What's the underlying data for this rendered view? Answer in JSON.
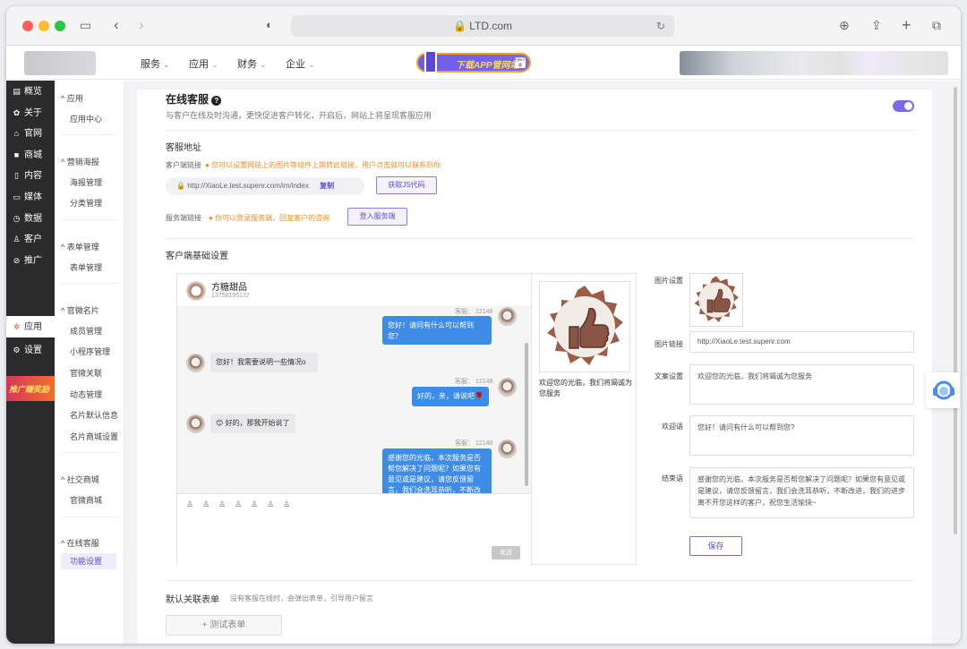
{
  "browser": {
    "url": "LTD.com"
  },
  "topnav": {
    "items": [
      "服务",
      "应用",
      "财务",
      "企业"
    ],
    "app_button": "下载APP管网站",
    "qr_text": "扫码下载"
  },
  "sidebar": {
    "items": [
      "概览",
      "关于",
      "官网",
      "商城",
      "内容",
      "媒体",
      "数据",
      "客户",
      "推广",
      "应用",
      "设置"
    ],
    "promo": "推广赚奖励"
  },
  "subsidebar": {
    "sections": [
      {
        "heading": "应用",
        "items": [
          "应用中心"
        ]
      },
      {
        "heading": "营销海报",
        "items": [
          "海报管理",
          "分类管理"
        ]
      },
      {
        "heading": "表单管理",
        "items": [
          "表单管理"
        ]
      },
      {
        "heading": "官微名片",
        "items": [
          "成员管理",
          "小程序管理",
          "官微关联",
          "动态管理",
          "名片默认信息",
          "名片商城设置"
        ]
      },
      {
        "heading": "社交商城",
        "items": [
          "官微商城"
        ]
      },
      {
        "heading": "在线客服",
        "items": [
          "功能设置"
        ]
      }
    ]
  },
  "main": {
    "title": "在线客服",
    "subtitle": "与客户在线及时沟通，更快促进客户转化，开启后，网站上将呈现客服应用",
    "address_title": "客服地址",
    "client_link_label": "客户端链接",
    "client_link_tip": "您可以设置网站上的图片等组件上跳转此链接，用户点击就可以联系到你",
    "client_link_value": "http://XiaoLe.test.supenr.com/im/index",
    "copy": "复制",
    "get_js": "获取JS代码",
    "server_link_label": "服务端链接",
    "server_link_tip": "你可以登录服务端，回复客户的咨询",
    "login_server": "登入服务端",
    "basic_title": "客户端基础设置",
    "default_form_title": "默认关联表单",
    "default_form_tip": "没有客服在线时，会弹出表单，引导用户留言",
    "add_form": "+ 测试表单"
  },
  "chat": {
    "shop_name": "方糖甜品",
    "phone": "13758195137",
    "messages": [
      {
        "side": "right",
        "meta": "客服： 12148",
        "text": "您好！请问有什么可以帮到您？"
      },
      {
        "side": "left",
        "text": "您好！我需要说明一些情况o"
      },
      {
        "side": "right",
        "meta": "客服： 12148",
        "text": "好的，亲，请说吧🌹"
      },
      {
        "side": "left",
        "text": "😊 好的，那我开始说了"
      },
      {
        "side": "right",
        "meta": "客服： 12148",
        "text": "感谢您的光临，本次服务是否帮您解决了问题呢？如果您有意见或是建议，请您反馈留言，我们会洗耳恭听，不断改"
      }
    ],
    "send": "发送",
    "preview_text": "欢迎您的光临，我们将竭诚为您服务"
  },
  "form": {
    "image_label": "图片设置",
    "link_label": "图片链接",
    "link_value": "http://XiaoLe.test.supenr.com",
    "copy_label": "文案设置",
    "copy_value": "欢迎您的光临，我们将竭诚为您服务",
    "welcome_label": "欢迎语",
    "welcome_value": "您好！请问有什么可以帮到您?",
    "end_label": "结束语",
    "end_value": "感谢您的光临，本次服务是否帮您解决了问题呢？如果您有意见或是建议，请您反馈留言，我们会洗耳恭听，不断改进，我们的进步离不开您这样的客户，祝您生活愉快~",
    "save": "保存"
  },
  "colors": {
    "accent": "#7b6ae6",
    "warn": "#f08c24",
    "bubble": "#3d8ce8"
  }
}
